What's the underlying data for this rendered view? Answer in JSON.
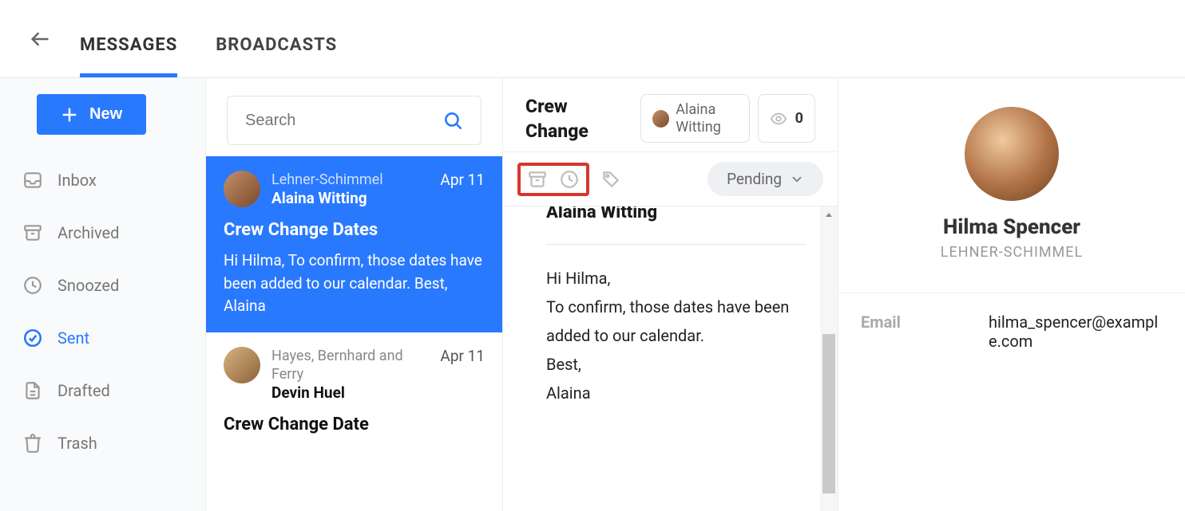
{
  "tabs": {
    "messages": "MESSAGES",
    "broadcasts": "BROADCASTS",
    "active": "messages"
  },
  "compose_button": "New",
  "sidebar": {
    "items": [
      {
        "key": "inbox",
        "label": "Inbox"
      },
      {
        "key": "archived",
        "label": "Archived"
      },
      {
        "key": "snoozed",
        "label": "Snoozed"
      },
      {
        "key": "sent",
        "label": "Sent"
      },
      {
        "key": "drafted",
        "label": "Drafted"
      },
      {
        "key": "trash",
        "label": "Trash"
      }
    ],
    "active": "sent"
  },
  "search": {
    "placeholder": "Search"
  },
  "messages": [
    {
      "org": "Lehner-Schimmel",
      "sender": "Alaina Witting",
      "date": "Apr 11",
      "subject": "Crew Change Dates",
      "preview": "Hi Hilma, To confirm, those dates have been added to our calendar. Best, Alaina",
      "selected": true
    },
    {
      "org": "Hayes, Bernhard and Ferry",
      "sender": "Devin Huel",
      "date": "Apr 11",
      "subject": "Crew Change Date",
      "preview": "",
      "selected": false
    }
  ],
  "conversation": {
    "title": "Crew Change",
    "participant": "Alaina Witting",
    "view_count": "0",
    "status": "Pending",
    "from": "Alaina Witting",
    "body": "Hi Hilma,\nTo confirm, those dates have been added to our calendar.\nBest,\nAlaina"
  },
  "contact": {
    "name": "Hilma Spencer",
    "org": "LEHNER-SCHIMMEL",
    "fields": {
      "email_label": "Email",
      "email_value": "hilma_spencer@example.com"
    }
  },
  "colors": {
    "accent": "#2979ff",
    "highlight": "#d6362f"
  }
}
